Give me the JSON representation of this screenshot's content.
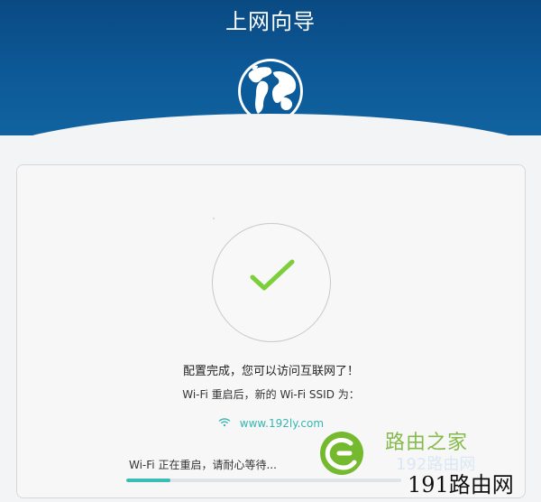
{
  "header": {
    "title": "上网向导",
    "globe_icon": "globe-icon",
    "background_color": "#0d5a99"
  },
  "card": {
    "success_icon": "check-icon",
    "message_main": "配置完成，您可以访问互联网了！",
    "message_sub": "Wi-Fi 重启后，新的 Wi-Fi SSID 为：",
    "ssid": "www.192ly.com",
    "wifi_icon": "wifi-icon",
    "restart_status": "Wi-Fi 正在重启，请耐心等待...",
    "progress_percent": 16,
    "accent_color": "#39bdb5",
    "check_color": "#7ccf3a"
  },
  "watermark": {
    "brand": "路由之家",
    "ghost_text": "192路由网",
    "site_text": "191路由网"
  }
}
